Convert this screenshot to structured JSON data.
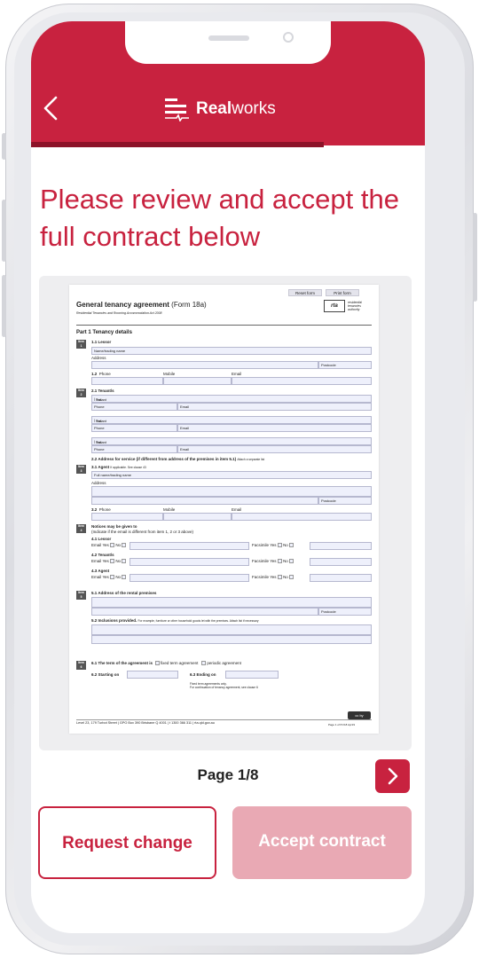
{
  "app": {
    "brand_bold": "Real",
    "brand_light": "works"
  },
  "heading": "Please review and accept the full contract below",
  "pager": {
    "label": "Page 1/8"
  },
  "actions": {
    "request_change": "Request change",
    "accept_contract": "Accept contract"
  },
  "colors": {
    "brand": "#c8223f",
    "accent_dark": "#8c1228",
    "disabled": "#e9a9b4"
  },
  "form": {
    "reset": "Reset form",
    "print": "Print form",
    "title_bold": "General tenancy agreement",
    "title_rest": " (Form 18a)",
    "subtitle": "Residential Tenancies and Rooming Accommodation Act 2008",
    "rta_logo": "rta",
    "rta_text": [
      "residential",
      "tenancies",
      "authority"
    ],
    "part1": "Part 1 Tenancy details",
    "item": "Item",
    "s1_1": "1.1 Lessor",
    "name_trading": "Name/trading name",
    "address": "Address",
    "postcode": "Postcode",
    "s1_2": "1.2",
    "phone": "Phone",
    "mobile": "Mobile",
    "email": "Email",
    "s2_1": "2.1 Tenant/s",
    "tenant1": "Tenant 1",
    "tenant2": "Tenant 2",
    "tenant3": "Tenant 3",
    "full_names": "Full name/s",
    "s2_2": "2.2 Address for service (if different from address of the premises in item 5.1)",
    "s2_2_note": "Attach a separate list",
    "s3_1": "3.1 Agent",
    "s3_1_note": "If applicable. See clause 43",
    "full_name_trading": "Full name/trading name",
    "s3_2": "3.2",
    "s4_head": "Notices may be given to",
    "s4_note": "(Indicate if the email is different from item 1, 2 or 3 above)",
    "s4_1": "4.1 Lessor",
    "s4_2": "4.2 Tenant/s",
    "s4_3": "4.3 Agent",
    "email_lbl": "Email",
    "yes": "Yes",
    "no": "No",
    "facsimile": "Facsimile",
    "s5_1": "5.1 Address of the rental premises",
    "s5_2": "5.2 Inclusions provided.",
    "s5_2_note": "For example, furniture or other household goods let with the premises. Attach list if necessary",
    "s6_1": "6.1 The term of the agreement is",
    "fixed": "fixed term agreement",
    "periodic": "periodic agreement",
    "s6_2": "6.2 Starting on",
    "s6_3": "6.3 Ending on",
    "fixed_note1": "Fixed term agreements only.",
    "fixed_note2": "For continuation of tenancy agreement, see clause 6",
    "cc": "cc by",
    "footer": "Level 23, 179 Turbot Street | GPO Box 390 Brisbane Q 4001 | t 1300 366 311 | rta.qld.gov.au",
    "footer_right": "Page 1 of 8   F18 Apr19"
  }
}
